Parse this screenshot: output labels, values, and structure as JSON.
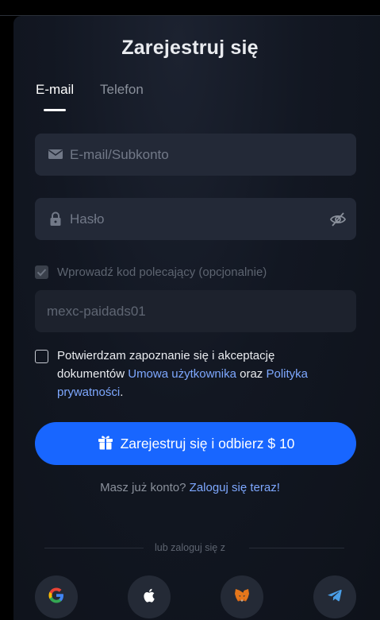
{
  "header": {
    "title": "Zarejestruj się"
  },
  "tabs": [
    {
      "label": "E-mail",
      "active": true
    },
    {
      "label": "Telefon",
      "active": false
    }
  ],
  "email": {
    "placeholder": "E-mail/Subkonto",
    "icon": "mail-icon"
  },
  "password": {
    "placeholder": "Hasło",
    "icon": "lock-icon",
    "toggle_icon": "eye-off-icon"
  },
  "referral": {
    "label": "Wprowadź kod polecający (opcjonalnie)",
    "checked": true,
    "code": "mexc-paidads01"
  },
  "terms": {
    "text_before": "Potwierdzam zapoznanie się i akceptację dokumentów",
    "link_user_agreement": "Umowa użytkownika",
    "text_and": "oraz",
    "link_privacy": "Polityka prywatności",
    "text_end": "."
  },
  "cta": {
    "label": "Zarejestruj się i odbierz $ 10",
    "icon": "gift-icon",
    "color": "#1866ff"
  },
  "login": {
    "prompt": "Masz już konto?",
    "link": "Zaloguj się teraz!"
  },
  "social": {
    "divider": "lub zaloguj się z",
    "providers": [
      "google-icon",
      "apple-icon",
      "metamask-icon",
      "telegram-icon"
    ]
  },
  "colors": {
    "accent": "#1866ff",
    "link": "#7ea8ff",
    "field_bg": "#232937"
  }
}
